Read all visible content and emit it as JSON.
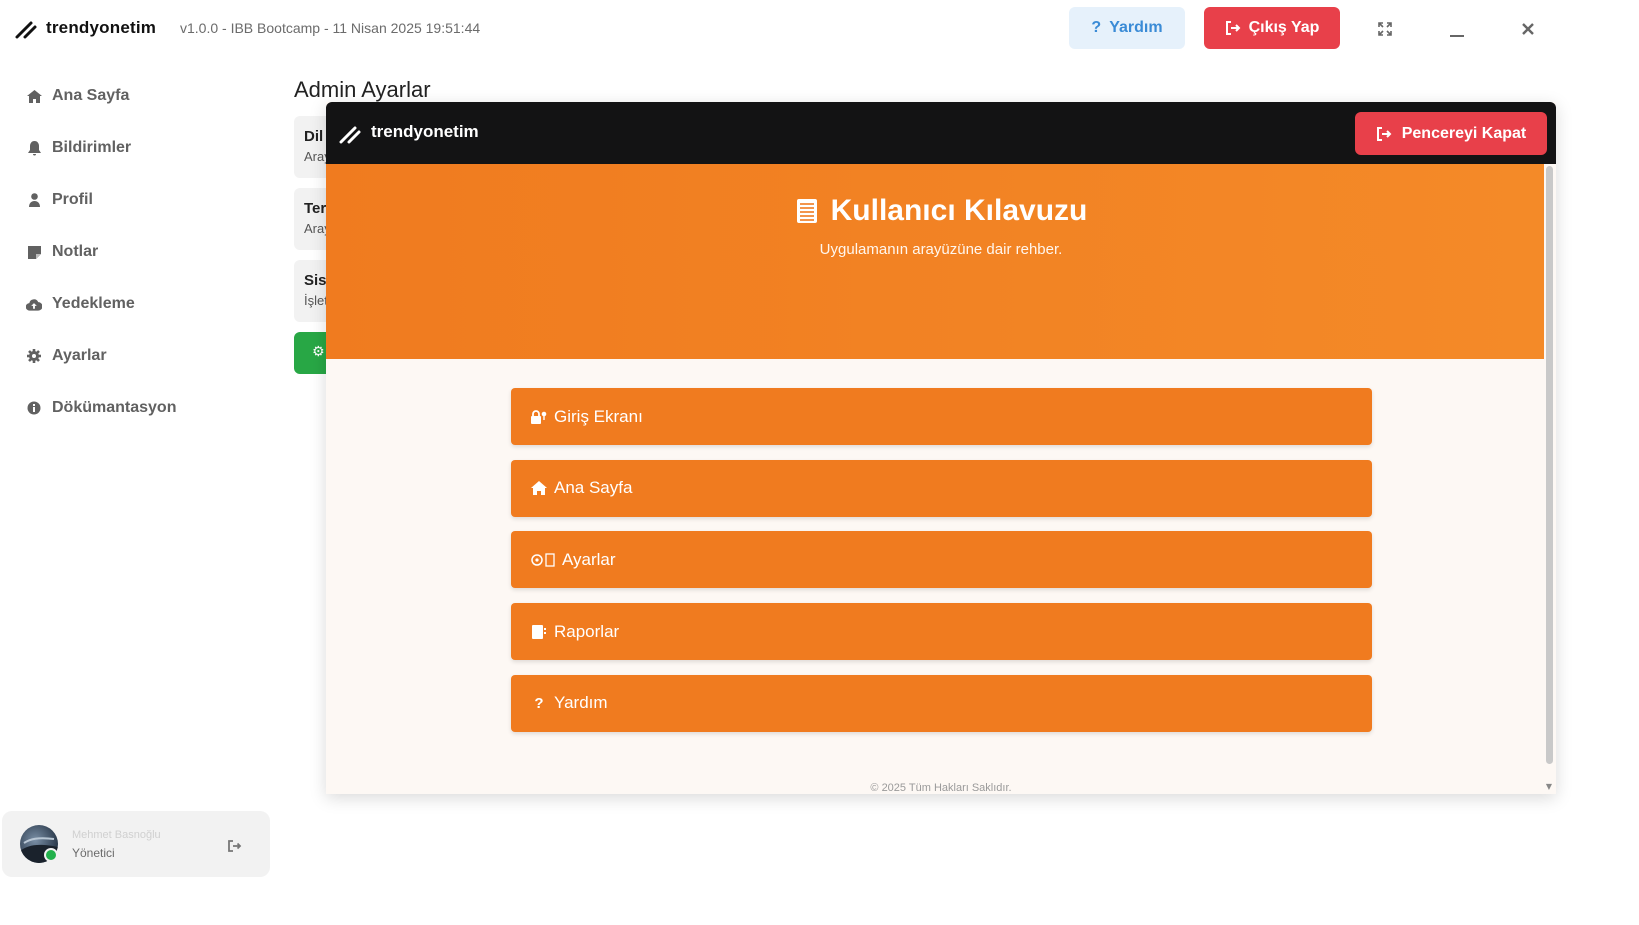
{
  "app": {
    "brand": "trendyonetim",
    "version_info": "v1.0.0 - IBB Bootcamp - 11 Nisan 2025  19:51:44"
  },
  "header": {
    "help_label": "Yardım",
    "logout_label": "Çıkış Yap"
  },
  "sidebar": {
    "items": [
      {
        "label": "Ana Sayfa",
        "icon": "home-icon"
      },
      {
        "label": "Bildirimler",
        "icon": "bell-icon"
      },
      {
        "label": "Profil",
        "icon": "user-icon"
      },
      {
        "label": "Notlar",
        "icon": "note-icon"
      },
      {
        "label": "Yedekleme",
        "icon": "cloud-upload-icon"
      },
      {
        "label": "Ayarlar",
        "icon": "gear-icon"
      },
      {
        "label": "Dökümantasyon",
        "icon": "info-icon"
      }
    ]
  },
  "user": {
    "name": "Mehmet Basnoğlu",
    "role": "Yönetici",
    "status_color": "#22b14c"
  },
  "background_page": {
    "title": "Admin Ayarlar",
    "cards": [
      {
        "title": "Dil",
        "subtitle": "Aray"
      },
      {
        "title": "Ter",
        "subtitle": "Aray"
      },
      {
        "title": "Sist",
        "subtitle": "İşlet"
      }
    ]
  },
  "modal": {
    "brand": "trendyonetim",
    "close_label": "Pencereyi Kapat",
    "hero_title": "Kullanıcı Kılavuzu",
    "hero_subtitle": "Uygulamanın arayüzüne dair rehber.",
    "guide_items": [
      {
        "label": "Giriş Ekranı",
        "icon": "lock-key-icon"
      },
      {
        "label": "Ana Sayfa",
        "icon": "house-icon"
      },
      {
        "label": "Ayarlar",
        "icon": "gear-icon"
      },
      {
        "label": "Raporlar",
        "icon": "report-icon"
      },
      {
        "label": "Yardım",
        "icon": "question-icon"
      }
    ],
    "footer": "© 2025 Tüm Hakları Saklıdır."
  },
  "colors": {
    "accent_orange": "#f07b1f",
    "danger_red": "#e8404a",
    "help_blue": "#3a8bd6",
    "modal_header": "#131314"
  }
}
